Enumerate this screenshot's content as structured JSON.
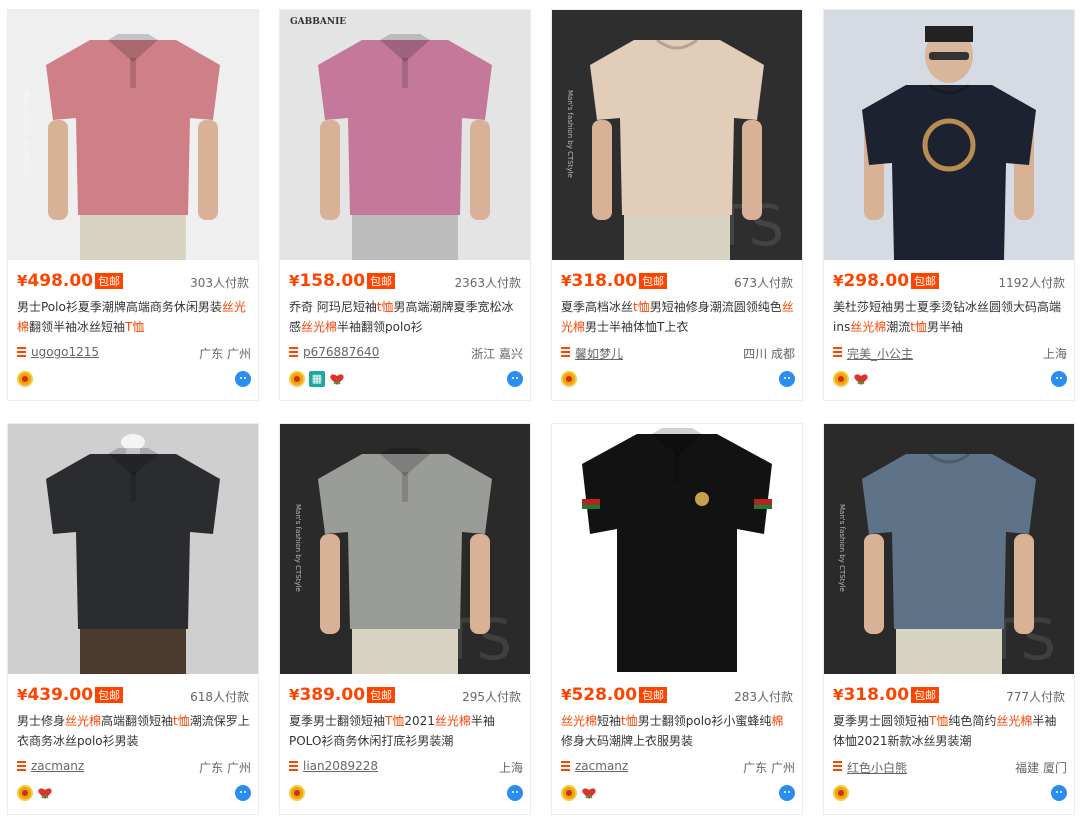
{
  "products": [
    {
      "price": "498.00",
      "baoyou": "包邮",
      "paid": "303人付款",
      "title": [
        {
          "t": "男士Polo衫夏季潮牌高端商务休闲男装"
        },
        {
          "t": "丝光棉",
          "hl": true
        },
        {
          "t": "翻领半袖冰丝短袖"
        },
        {
          "t": "T恤",
          "hl": true
        }
      ],
      "shop": "ugogo1215",
      "location": "广东 广州",
      "badges": [
        "medal-badge-icon"
      ],
      "shirt": {
        "bg": "#efefef",
        "color": "#cf7f86",
        "type": "polo",
        "pants": "#d8d3c2",
        "watermark": true
      }
    },
    {
      "price": "158.00",
      "baoyou": "包邮",
      "paid": "2363人付款",
      "title": [
        {
          "t": "乔奇 阿玛尼短袖"
        },
        {
          "t": "t恤",
          "hl": true
        },
        {
          "t": "男高端潮牌夏季宽松冰感"
        },
        {
          "t": "丝光棉",
          "hl": true
        },
        {
          "t": "半袖翻领polo衫"
        }
      ],
      "shop": "p676887640",
      "location": "浙江 嘉兴",
      "badges": [
        "medal-badge-icon",
        "fashion-badge-icon",
        "heart-badge-icon"
      ],
      "shirt": {
        "bg": "#e4e4e4",
        "color": "#c4799a",
        "type": "polo",
        "pants": "#bcbcbc",
        "brand_text": "GABBANIE"
      }
    },
    {
      "price": "318.00",
      "baoyou": "包邮",
      "paid": "673人付款",
      "title": [
        {
          "t": "夏季高档冰丝"
        },
        {
          "t": "t恤",
          "hl": true
        },
        {
          "t": "男短袖修身潮流圆领纯色"
        },
        {
          "t": "丝光棉",
          "hl": true
        },
        {
          "t": "男士半袖体恤T上衣"
        }
      ],
      "shop": "馨如梦儿",
      "location": "四川 成都",
      "badges": [
        "medal-badge-icon"
      ],
      "shirt": {
        "bg": "#2e2e2e",
        "color": "#e1cdb8",
        "type": "tee",
        "pants": "#d8d3c2",
        "watermark": true
      }
    },
    {
      "price": "298.00",
      "baoyou": "包邮",
      "paid": "1192人付款",
      "title": [
        {
          "t": "美杜莎短袖男士夏季烫钻冰丝圆领大码高端ins"
        },
        {
          "t": "丝光棉",
          "hl": true
        },
        {
          "t": "潮流"
        },
        {
          "t": "t恤",
          "hl": true
        },
        {
          "t": "男半袖"
        }
      ],
      "shop": "完美_小公主",
      "location": "上海",
      "badges": [
        "medal-badge-icon",
        "heart-badge-icon"
      ],
      "shirt": {
        "bg": "#d6dbe3",
        "color": "#1d2230",
        "type": "tee",
        "pants": "#2a2a2a",
        "head": true
      }
    },
    {
      "price": "439.00",
      "baoyou": "包邮",
      "paid": "618人付款",
      "title": [
        {
          "t": "男士修身"
        },
        {
          "t": "丝光棉",
          "hl": true
        },
        {
          "t": "高端翻领短袖"
        },
        {
          "t": "t恤",
          "hl": true
        },
        {
          "t": "潮流保罗上衣商务冰丝polo衫男装"
        }
      ],
      "shop": "zacmanz",
      "location": "广东 广州",
      "badges": [
        "medal-badge-icon",
        "heart-badge-icon"
      ],
      "shirt": {
        "bg": "#cfcfcf",
        "color": "#2b2c30",
        "type": "polo",
        "pants": "#4b3a2e",
        "mannequin": true
      }
    },
    {
      "price": "389.00",
      "baoyou": "包邮",
      "paid": "295人付款",
      "title": [
        {
          "t": "夏季男士翻领短袖"
        },
        {
          "t": "T恤",
          "hl": true
        },
        {
          "t": "2021"
        },
        {
          "t": "丝光棉",
          "hl": true
        },
        {
          "t": "半袖POLO衫商务休闲打底衫男装潮"
        }
      ],
      "shop": "lian2089228",
      "location": "上海",
      "badges": [
        "medal-badge-icon"
      ],
      "shirt": {
        "bg": "#2a2a2a",
        "color": "#9a9c98",
        "type": "polo",
        "pants": "#d8d3c2",
        "watermark": true
      }
    },
    {
      "price": "528.00",
      "baoyou": "包邮",
      "paid": "283人付款",
      "title": [
        {
          "t": "丝光棉",
          "hl": true
        },
        {
          "t": "短袖"
        },
        {
          "t": "t恤",
          "hl": true
        },
        {
          "t": "男士翻领polo衫小蜜蜂纯"
        },
        {
          "t": "棉",
          "hl": true
        },
        {
          "t": "修身大码潮牌上衣服男装"
        }
      ],
      "shop": "zacmanz",
      "location": "广东 广州",
      "badges": [
        "medal-badge-icon",
        "heart-badge-icon"
      ],
      "shirt": {
        "bg": "#ffffff",
        "color": "#121212",
        "type": "polo-flat",
        "pants": "#ffffff"
      }
    },
    {
      "price": "318.00",
      "baoyou": "包邮",
      "paid": "777人付款",
      "title": [
        {
          "t": "夏季男士圆领短袖"
        },
        {
          "t": "T恤",
          "hl": true
        },
        {
          "t": "纯色简约"
        },
        {
          "t": "丝光棉",
          "hl": true
        },
        {
          "t": "半袖体恤2021新款冰丝男装潮"
        }
      ],
      "shop": "红色小白熊",
      "location": "福建 厦门",
      "badges": [
        "medal-badge-icon"
      ],
      "shirt": {
        "bg": "#2a2a2a",
        "color": "#5f7388",
        "type": "tee",
        "pants": "#d8d3c2",
        "watermark": true
      }
    }
  ],
  "watermark_text": "Man's fashion by CTStyle",
  "accent_color": "#ff4400",
  "wangwang_icon": "wangwang-chat-icon",
  "shop_icon": "shop-list-icon"
}
